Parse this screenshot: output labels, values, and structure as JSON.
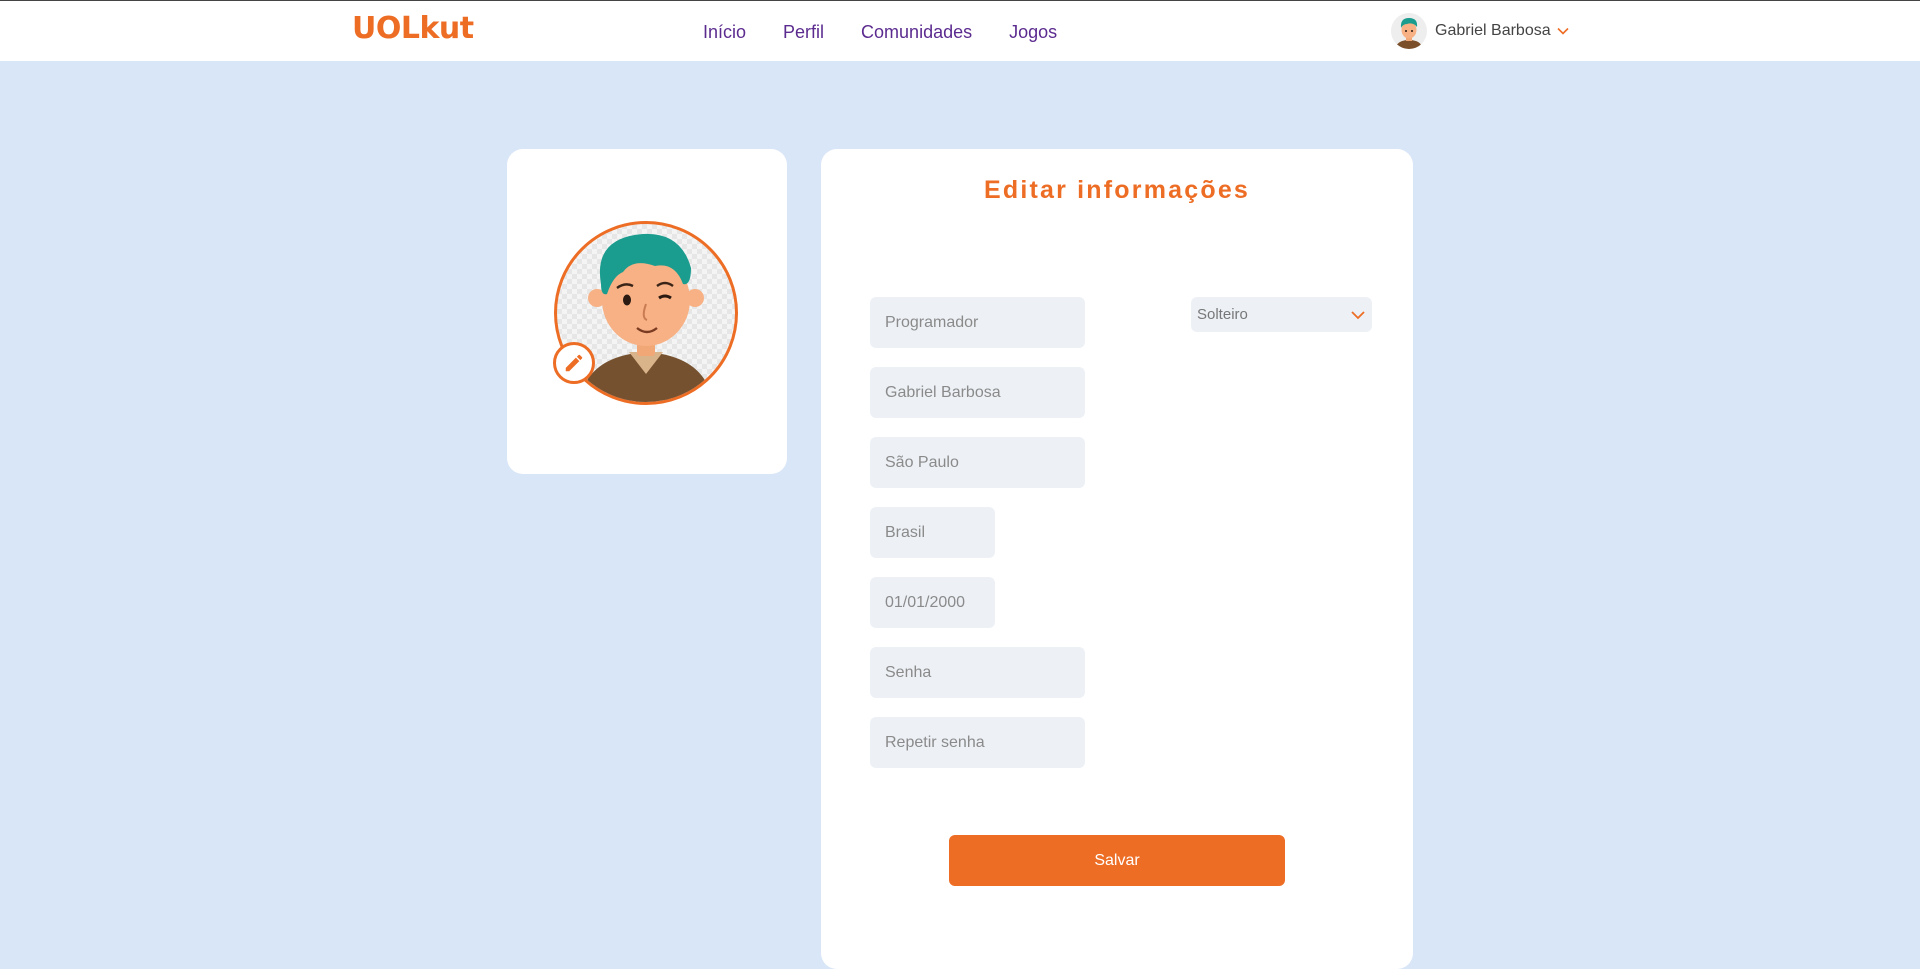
{
  "header": {
    "logo": "UOLkut",
    "nav": [
      "Início",
      "Perfil",
      "Comunidades",
      "Jogos"
    ],
    "user_name": "Gabriel Barbosa"
  },
  "form": {
    "title": "Editar informações",
    "fields": {
      "profession": "Programador",
      "name": "Gabriel Barbosa",
      "city": "São Paulo",
      "country": "Brasil",
      "birthdate": "01/01/2000",
      "password": "Senha",
      "repeat_password": "Repetir senha"
    },
    "relationship": "Solteiro",
    "save_label": "Salvar"
  },
  "colors": {
    "accent": "#ed6d25",
    "nav_link": "#5b2b8f",
    "background": "#d9e6f7",
    "input_bg": "#edf1f6"
  },
  "icons": {
    "edit": "pencil-icon",
    "dropdown": "chevron-down-icon"
  }
}
